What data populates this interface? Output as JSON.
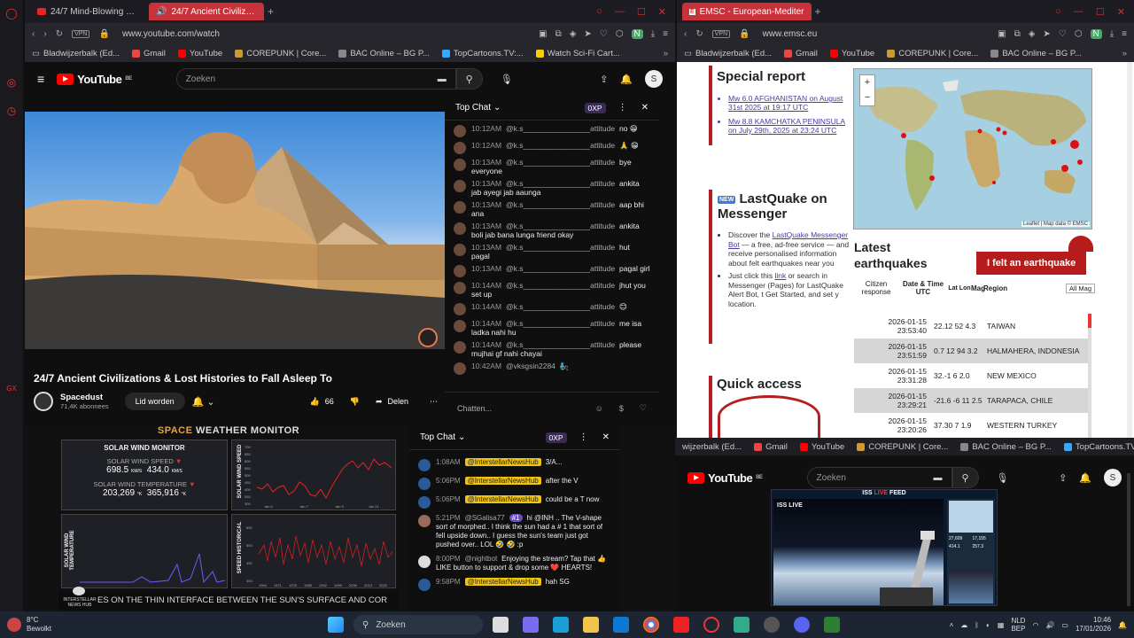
{
  "sidebar": {
    "icons": [
      "opera-icon",
      "target-icon",
      "history-icon"
    ]
  },
  "left_window": {
    "tabs": [
      {
        "label": "24/7 Mind-Blowing Space",
        "active": false
      },
      {
        "label": "24/7 Ancient Civilizatio",
        "active": true
      }
    ],
    "url": "www.youtube.com/watch",
    "vpn": "VPN",
    "bookmarks": [
      "Bladwijzerbalk (Ed...",
      "Gmail",
      "YouTube",
      "COREPUNK | Core...",
      "BAC Online – BG P...",
      "TopCartoons.TV:...",
      "Watch Sci-Fi Cart..."
    ],
    "yt": {
      "logo": "YouTube",
      "region": "BE",
      "search_placeholder": "Zoeken",
      "avatar": "S",
      "video_title": "24/7 Ancient Civilizations & Lost Histories to Fall Asleep To",
      "channel": "Spacedust",
      "subscribers": "71,4K abonnees",
      "join_button": "Lid worden",
      "likes": "66",
      "share": "Delen"
    },
    "chat": {
      "title": "Top Chat",
      "points": "0XP",
      "input_placeholder": "Chatten...",
      "messages": [
        {
          "time": "10:12AM",
          "user": "@k.s________________attitude",
          "text": "no 😁"
        },
        {
          "time": "10:12AM",
          "user": "@k.s________________attitude",
          "text": "🙏 😁"
        },
        {
          "time": "10:13AM",
          "user": "@k.s________________attitude",
          "text": "bye everyone"
        },
        {
          "time": "10:13AM",
          "user": "@k.s________________attitude",
          "text": "ankita jab ayegi jab aaunga"
        },
        {
          "time": "10:13AM",
          "user": "@k.s________________attitude",
          "text": "aap bhi ana"
        },
        {
          "time": "10:13AM",
          "user": "@k.s________________attitude",
          "text": "ankita boli jab bana lunga friend okay"
        },
        {
          "time": "10:13AM",
          "user": "@k.s________________attitude",
          "text": "hut pagal"
        },
        {
          "time": "10:13AM",
          "user": "@k.s________________attitude",
          "text": "pagal girl"
        },
        {
          "time": "10:14AM",
          "user": "@k.s________________attitude",
          "text": "jhut you set up"
        },
        {
          "time": "10:14AM",
          "user": "@k.s________________attitude",
          "text": "😊"
        },
        {
          "time": "10:14AM",
          "user": "@k.s________________attitude",
          "text": "me isa ladka nahi hu"
        },
        {
          "time": "10:14AM",
          "user": "@k.s________________attitude",
          "text": "please mujhai gf nahi chayai"
        },
        {
          "time": "10:42AM",
          "user": "@vksgsin2284",
          "text": "🧞"
        }
      ]
    }
  },
  "right_window": {
    "tabs": [
      {
        "label": "EMSC - European-Mediter",
        "active": true
      }
    ],
    "url": "www.emsc.eu",
    "vpn": "VPN",
    "bookmarks": [
      "Bladwijzerbalk (Ed...",
      "Gmail",
      "YouTube",
      "COREPUNK | Core...",
      "BAC Online – BG P..."
    ],
    "special_report": {
      "title": "Special report",
      "items": [
        "Mw 6.0 AFGHANISTAN on August 31st 2025 at 19:17 UTC",
        "Mw 8.8 KAMCHATKA PENINSULA on July 29th, 2025 at 23:24 UTC"
      ]
    },
    "lastquake": {
      "badge": "NEW",
      "title": "LastQuake on Messenger",
      "bullet1_pre": "Discover the ",
      "bullet1_link": "LastQuake Messenger Bot",
      "bullet1_post": " — a free, ad-free service — and receive personalised information about felt earthquakes near you",
      "bullet2_pre": "Just click this ",
      "bullet2_link": "link",
      "bullet2_post": " or search in Messenger (Pages) for LastQuake Alert Bot, t Get Started, and set y location."
    },
    "map": {
      "attribution": "Leaflet | Map data © EMSC",
      "zoom_in": "+",
      "zoom_out": "−"
    },
    "latest": {
      "title": "Latest earthquakes",
      "felt_button": "I felt an earthquake",
      "headers": [
        "Citizen response",
        "Date & Time UTC",
        "Lat Lon",
        "Mag",
        "Region"
      ],
      "filter": "All Mag",
      "rows": [
        {
          "date": "2026-01-15",
          "time": "23:53:40",
          "vals": "22.12 52 4.3",
          "region": "TAIWAN"
        },
        {
          "date": "2026-01-15",
          "time": "23:51:59",
          "vals": "0.7 12 94 3.2",
          "region": "HALMAHERA, INDONESIA"
        },
        {
          "date": "2026-01-15",
          "time": "23:31:28",
          "vals": "32.-1 6 2.0",
          "region": "NEW MEXICO"
        },
        {
          "date": "2026-01-15",
          "time": "23:29:21",
          "vals": "-21.6 -6 11 2.5",
          "region": "TARAPACA, CHILE"
        },
        {
          "date": "2026-01-15",
          "time": "23:20:26",
          "vals": "37.30 7 1.9",
          "region": "WESTERN TURKEY"
        }
      ]
    },
    "quick_access": {
      "title": "Quick access"
    }
  },
  "bottom_left": {
    "header": "SPACE WEATHER MONITOR",
    "header_parts": [
      "SPACE",
      "WEATHER MONITOR"
    ],
    "panel_title": "SOLAR WIND MONITOR",
    "speed_label": "SOLAR WIND SPEED",
    "speed_1": "698.5",
    "speed_2": "434.0",
    "speed_unit": "KM/S",
    "temp_label": "SOLAR WIND TEMPERATURE",
    "temp_1": "203,269",
    "temp_2": "365,916",
    "temp_unit": "°K",
    "chart_speed_label": "SOLAR WIND SPEED",
    "chart_temp_label": "SOLAR WIND TEMPERATURE",
    "chart_hist_label": "SPEED HISTORICAL",
    "speed_ticks_y": [
      "700",
      "650",
      "600",
      "550",
      "500",
      "450",
      "400",
      "350",
      "300"
    ],
    "speed_ticks_x": [
      "Jan 5",
      "Jan 7",
      "Jan 9",
      "Jan 11"
    ],
    "hist_ticks_y": [
      "600",
      "500",
      "400",
      "300"
    ],
    "hist_ticks_x": [
      "1964",
      "1971",
      "1978",
      "1985",
      "1992",
      "1999",
      "2006",
      "2013",
      "2020"
    ],
    "ticker": "ES ON THE THIN INTERFACE BETWEEN THE SUN'S SURFACE AND COR",
    "logo": "INTERSTELLAR NEWS HUB"
  },
  "bottom_chat": {
    "title": "Top Chat",
    "points": "0XP",
    "messages": [
      {
        "time": "1:08AM",
        "user": "@InterstellarNewsHub",
        "text": "3/A..."
      },
      {
        "time": "5:06PM",
        "user": "@InterstellarNewsHub",
        "text": "after the V"
      },
      {
        "time": "5:06PM",
        "user": "@InterstellarNewsHub",
        "text": "could be a T now"
      },
      {
        "time": "5:21PM",
        "user": "@SGalisa77",
        "badge": "#1",
        "text": "hi @INH .. The V-shape sort of morphed.. I think the sun had a # 1 that sort of fell upside down.. I guess the sun's team just got pushed over.. LOL 🤣 🤣 :p"
      },
      {
        "time": "8:00PM",
        "user": "@nightbot",
        "text": "Enjoying the stream? Tap that 👍 LIKE button to support & drop some ❤️ HEARTS!"
      },
      {
        "time": "9:58PM",
        "user": "@InterstellarNewsHub",
        "text": "hah SG"
      }
    ]
  },
  "bottom_right": {
    "bookmarks": [
      "wijzerbalk (Ed...",
      "Gmail",
      "YouTube",
      "COREPUNK | Core...",
      "BAC Online – BG P...",
      "TopCartoons.TV:..."
    ],
    "search_placeholder": "Zoeken",
    "logo": "YouTube",
    "region": "BE",
    "avatar": "S",
    "iss_title_pre": "ISS",
    "iss_title_live": "LIVE",
    "iss_title_post": "FEED",
    "iss_live": "ISS LIVE",
    "stats": [
      "27,609",
      "17,155",
      "414.1",
      "257.3"
    ]
  },
  "taskbar": {
    "weather_temp": "8°C",
    "weather_desc": "Bewolkt",
    "search": "Zoeken",
    "lang": "NLD",
    "lang2": "BEP",
    "time": "10:46",
    "date": "17/01/2026"
  },
  "colors": {
    "accent": "#c8323a",
    "yt_red": "#ff0000",
    "emsc_red": "#b21f24",
    "badge_yellow": "#f1c40f"
  }
}
